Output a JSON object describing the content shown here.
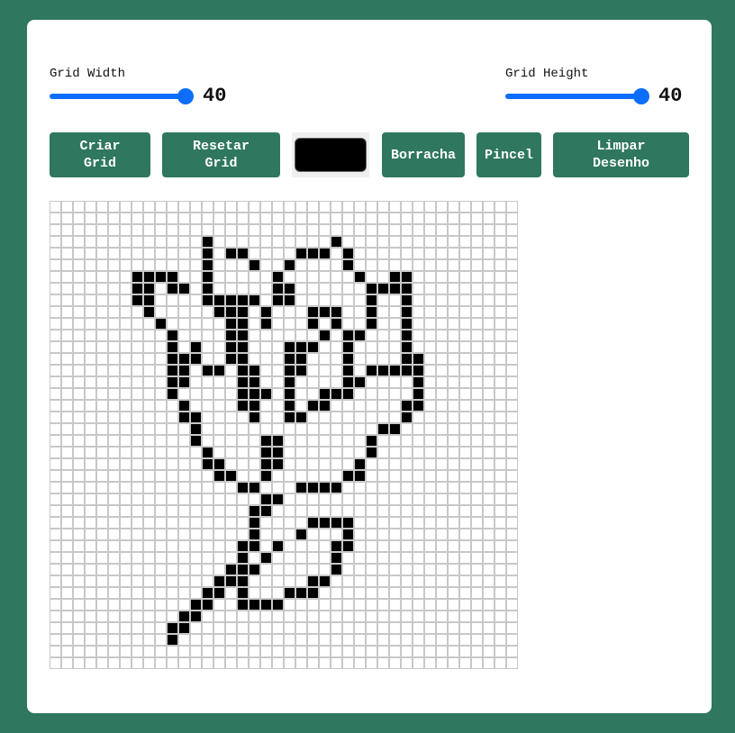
{
  "controls": {
    "width_label": "Grid Width",
    "width_value": "40",
    "width_fraction": 1.0,
    "height_label": "Grid Height",
    "height_value": "40",
    "height_fraction": 1.0
  },
  "buttons": {
    "create": "Criar\nGrid",
    "reset": "Resetar\nGrid",
    "eraser": "Borracha",
    "brush": "Pincel",
    "clear": "Limpar\nDesenho"
  },
  "colors": {
    "accent": "#2f775f",
    "slider": "#0d6efd",
    "selected_color": "#000000"
  },
  "grid": {
    "columns": 40,
    "rows": 40,
    "filled_rows": {
      "3": [
        13,
        24
      ],
      "4": [
        13,
        15,
        16,
        21,
        22,
        23,
        25
      ],
      "5": [
        13,
        17,
        20,
        25
      ],
      "6": [
        7,
        8,
        9,
        10,
        13,
        19,
        26,
        29,
        30
      ],
      "7": [
        7,
        8,
        10,
        11,
        13,
        19,
        20,
        27,
        28,
        29,
        30
      ],
      "8": [
        7,
        8,
        13,
        14,
        15,
        16,
        17,
        19,
        20,
        27,
        30
      ],
      "9": [
        8,
        14,
        15,
        16,
        18,
        22,
        23,
        24,
        27,
        30
      ],
      "10": [
        9,
        15,
        16,
        18,
        22,
        24,
        27,
        30
      ],
      "11": [
        10,
        15,
        16,
        23,
        25,
        26,
        30
      ],
      "12": [
        10,
        12,
        15,
        16,
        20,
        21,
        22,
        25,
        30
      ],
      "13": [
        10,
        11,
        12,
        15,
        16,
        20,
        21,
        25,
        30,
        31
      ],
      "14": [
        10,
        11,
        13,
        14,
        16,
        17,
        20,
        21,
        25,
        27,
        28,
        29,
        30,
        31
      ],
      "15": [
        10,
        11,
        16,
        17,
        20,
        25,
        26,
        31
      ],
      "16": [
        10,
        16,
        17,
        18,
        20,
        23,
        24,
        25,
        31
      ],
      "17": [
        11,
        16,
        17,
        20,
        22,
        23,
        30,
        31
      ],
      "18": [
        11,
        12,
        17,
        20,
        21,
        30
      ],
      "19": [
        12,
        28,
        29
      ],
      "20": [
        12,
        18,
        19,
        27
      ],
      "21": [
        13,
        18,
        19,
        27
      ],
      "22": [
        13,
        14,
        18,
        19,
        26
      ],
      "23": [
        14,
        15,
        18,
        25,
        26
      ],
      "24": [
        16,
        17,
        21,
        22,
        23,
        24
      ],
      "25": [
        18,
        19
      ],
      "26": [
        17,
        18
      ],
      "27": [
        17,
        22,
        23,
        24,
        25
      ],
      "28": [
        17,
        21,
        25
      ],
      "29": [
        16,
        17,
        19,
        24,
        25
      ],
      "30": [
        16,
        18,
        24
      ],
      "31": [
        15,
        16,
        17,
        24
      ],
      "32": [
        14,
        15,
        16,
        22,
        23
      ],
      "33": [
        13,
        14,
        16,
        20,
        21,
        22
      ],
      "34": [
        12,
        13,
        16,
        17,
        18,
        19
      ],
      "35": [
        11,
        12
      ],
      "36": [
        10,
        11
      ],
      "37": [
        10
      ]
    }
  }
}
